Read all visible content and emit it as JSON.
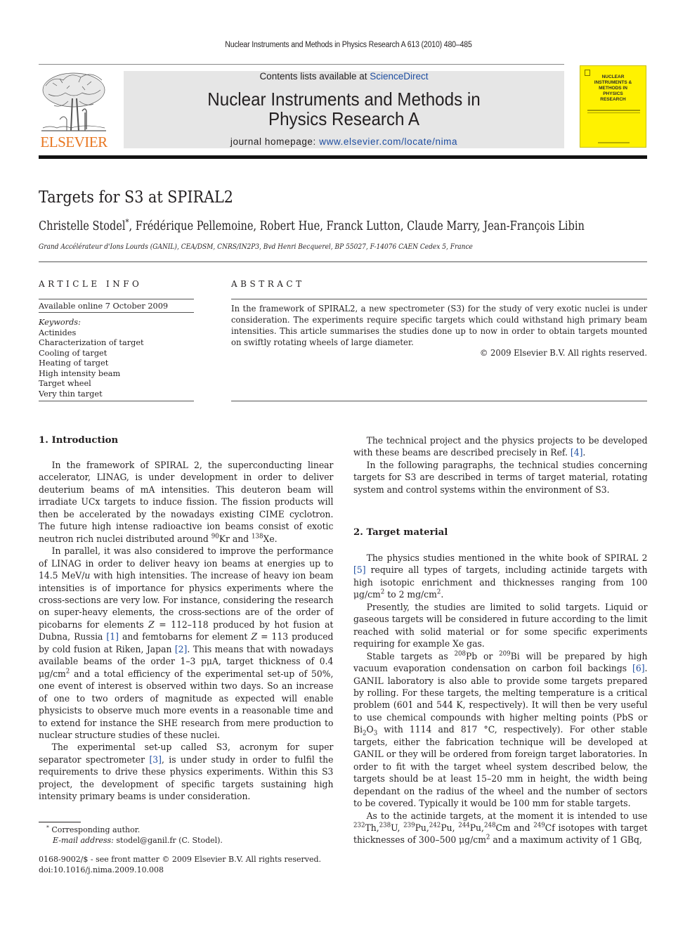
{
  "header": {
    "running_head": "Nuclear Instruments and Methods in Physics Research A 613 (2010) 480–485",
    "publisher_logo_text": "ELSEVIER",
    "contents_prefix": "Contents lists available at ",
    "contents_link": "ScienceDirect",
    "journal_title_line1": "Nuclear Instruments and Methods in",
    "journal_title_line2": "Physics Research A",
    "homepage_prefix": "journal homepage: ",
    "homepage_link": "www.elsevier.com/locate/nima",
    "cover_title": "NUCLEAR INSTRUMENTS & METHODS IN PHYSICS RESEARCH",
    "colors": {
      "elsevier_orange": "#e87722",
      "link_blue": "#1f4ea1",
      "cover_yellow": "#fff200",
      "masthead_gray": "#e6e6e6"
    }
  },
  "article": {
    "title": "Targets for S3 at SPIRAL2",
    "authors": "Christelle Stodel",
    "authors_mark": "*",
    "authors_rest": ", Frédérique Pellemoine, Robert Hue, Franck Lutton, Claude Marry, Jean-François Libin",
    "affiliation": "Grand Accélérateur d'Ions Lourds (GANIL), CEA/DSM, CNRS/IN2P3, Bvd Henri Becquerel, BP 55027, F-14076 CAEN Cedex 5, France"
  },
  "article_info": {
    "heading": "ARTICLE INFO",
    "available_online": "Available online 7 October 2009",
    "keywords_label": "Keywords:",
    "keywords": [
      "Actinides",
      "Characterization of target",
      "Cooling of target",
      "Heating of target",
      "High intensity beam",
      "Target wheel",
      "Very thin target"
    ]
  },
  "abstract": {
    "heading": "ABSTRACT",
    "text": "In the framework of SPIRAL2, a new spectrometer (S3) for the study of very exotic nuclei is under consideration. The experiments require specific targets which could withstand high primary beam intensities. This article summarises the studies done up to now in order to obtain targets mounted on swiftly rotating wheels of large diameter.",
    "copyright": "© 2009 Elsevier B.V. All rights reserved."
  },
  "body": {
    "sec1_heading": "1.  Introduction",
    "sec1_p1_a": "In the framework of SPIRAL 2, the superconducting linear accelerator, LINAG, is under development in order to deliver deuterium beams of mA intensities. This deuteron beam will irradiate UCx targets to induce fission. The fission products will then be accelerated by the nowadays existing CIME cyclotron. The future high intense radioactive ion beams consist of exotic neutron rich nuclei distributed around ",
    "sec1_p1_sup1": "90",
    "sec1_p1_b": "Kr and ",
    "sec1_p1_sup2": "138",
    "sec1_p1_c": "Xe.",
    "sec1_p2_a": "In parallel, it was also considered to improve the performance of LINAG in order to deliver heavy ion beams at energies up to 14.5 MeV/",
    "sec1_p2_u": "u",
    "sec1_p2_b": " with high intensities. The increase of heavy ion beam intensities is of importance for physics experiments where the cross-sections are very low. For instance, considering the research on super-heavy elements, the cross-sections are of the order of picobarns for elements ",
    "sec1_p2_z1": "Z",
    "sec1_p2_c": " = 112–118 produced by hot fusion at Dubna, Russia ",
    "ref1": "[1]",
    "sec1_p2_d": " and femtobarns for element ",
    "sec1_p2_z2": "Z",
    "sec1_p2_e": " = 113 produced by cold fusion at Riken, Japan ",
    "ref2": "[2]",
    "sec1_p2_f": ". This means that with nowadays available beams of the order 1–3 pμA, target thickness of 0.4 μg/cm",
    "sec1_p2_sup": "2",
    "sec1_p2_g": " and a total efficiency of the experimental set-up of 50%, one event of interest is observed within two days. So an increase of one to two orders of magnitude as expected will enable physicists to observe much more events in a reasonable time and to extend for instance the SHE research from mere production to nuclear structure studies of these nuclei.",
    "sec1_p3_a": "The experimental set-up called S3, acronym for super separator spectrometer ",
    "ref3": "[3]",
    "sec1_p3_b": ", is under study in order to fulfil the requirements to drive these physics experiments. Within this S3 project, the development of specific targets sustaining high intensity primary beams is under consideration.",
    "sec1_p4_a": "The technical project and the physics projects to be developed with these beams are described precisely in Ref. ",
    "ref4": "[4]",
    "sec1_p4_b": ".",
    "sec1_p5": "In the following paragraphs, the technical studies concerning targets for S3 are described in terms of target material, rotating system and control systems within the environment of S3.",
    "sec2_heading": "2.  Target material",
    "sec2_p1_a": "The physics studies mentioned in the white book of SPIRAL 2 ",
    "ref5": "[5]",
    "sec2_p1_b": " require all types of targets, including actinide targets with high isotopic enrichment and thicknesses ranging from 100 μg/cm",
    "sec2_p1_sup1": "2",
    "sec2_p1_c": " to 2 mg/cm",
    "sec2_p1_sup2": "2",
    "sec2_p1_d": ".",
    "sec2_p2": "Presently, the studies are limited to solid targets. Liquid or gaseous targets will be considered in future according to the limit reached with solid material or for some specific experiments requiring for example Xe gas.",
    "sec2_p3_a": "Stable targets as ",
    "sec2_p3_sup1": "208",
    "sec2_p3_b": "Pb or ",
    "sec2_p3_sup2": "209",
    "sec2_p3_c": "Bi will be prepared by high vacuum evaporation condensation on carbon foil backings ",
    "ref6": "[6]",
    "sec2_p3_d": ". GANIL laboratory is also able to provide some targets prepared by rolling. For these targets, the melting temperature is a critical problem (601 and 544 K, respectively). It will then be very useful to use chemical compounds with higher melting points (PbS or Bi",
    "sec2_p3_sub1": "2",
    "sec2_p3_e": "O",
    "sec2_p3_sub2": "3",
    "sec2_p3_f": " with 1114 and 817 °C, respectively). For other stable targets, either the fabrication technique will be developed at GANIL or they will be ordered from foreign target laboratories. In order to fit with the target wheel system described below, the targets should be at least 15–20 mm in height, the width being dependant on the radius of the wheel and the number of sectors to be covered. Typically it would be 100 mm for stable targets.",
    "sec2_p4_a": "As to the actinide targets, at the moment it is intended to use ",
    "iso": [
      {
        "mass": "232",
        "el": "Th,"
      },
      {
        "mass": "238",
        "el": "U, "
      },
      {
        "mass": "239",
        "el": "Pu,"
      },
      {
        "mass": "242",
        "el": "Pu, "
      },
      {
        "mass": "244",
        "el": "Pu,"
      },
      {
        "mass": "248",
        "el": "Cm and "
      },
      {
        "mass": "249",
        "el": "Cf"
      }
    ],
    "sec2_p4_b": " isotopes with target thicknesses of 300–500 μg/cm",
    "sec2_p4_sup": "2",
    "sec2_p4_c": " and a maximum activity of 1 GBq,"
  },
  "footnotes": {
    "mark": "*",
    "corresponding": " Corresponding author.",
    "email_label": "E-mail address:",
    "email": " stodel@ganil.fr (C. Stodel).",
    "front_matter": "0168-9002/$ - see front matter © 2009 Elsevier B.V. All rights reserved.",
    "doi": "doi:10.1016/j.nima.2009.10.008"
  }
}
